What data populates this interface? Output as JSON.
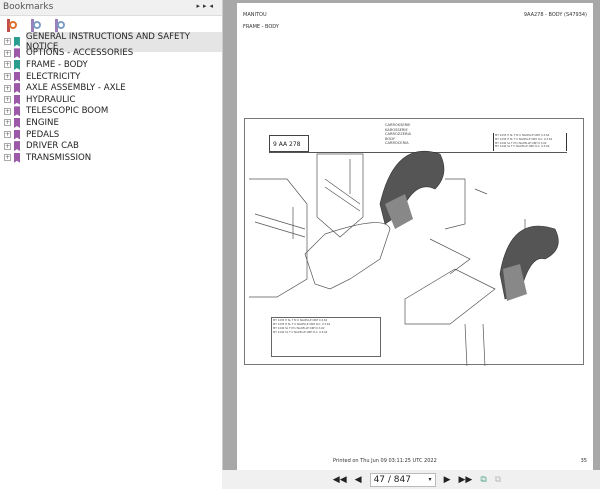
{
  "bookmarks": {
    "title": "Bookmarks",
    "items": [
      {
        "label": "GENERAL INSTRUCTIONS AND SAFETY NOTICE",
        "color": "#2a9d8f"
      },
      {
        "label": "OPTIONS - ACCESSORIES",
        "color": "#9b59a8"
      },
      {
        "label": "FRAME - BODY",
        "color": "#2a9d8f"
      },
      {
        "label": "ELECTRICITY",
        "color": "#9b59a8"
      },
      {
        "label": "AXLE ASSEMBLY - AXLE",
        "color": "#9b59a8"
      },
      {
        "label": "HYDRAULIC",
        "color": "#9b59a8"
      },
      {
        "label": "TELESCOPIC BOOM",
        "color": "#9b59a8"
      },
      {
        "label": "ENGINE",
        "color": "#9b59a8"
      },
      {
        "label": "PEDALS",
        "color": "#9b59a8"
      },
      {
        "label": "DRIVER CAB",
        "color": "#9b59a8"
      },
      {
        "label": "TRANSMISSION",
        "color": "#9b59a8"
      }
    ]
  },
  "page": {
    "brand": "MANITOU",
    "doc_ref": "9AA278 - BODY (S47934)",
    "section": "FRAME - BODY",
    "drawing_code": "9 AA 278",
    "drawing_titles": [
      "CARROSSERIE",
      "KAROSSERIE",
      "CARROZZERIA",
      "BODY",
      "CARROCERIA"
    ],
    "printed_on": "Printed on  Thu Jun 09 03:11:25 UTC 2022",
    "page_number": "35"
  },
  "toolbar": {
    "page_indicator": "47 / 847"
  }
}
